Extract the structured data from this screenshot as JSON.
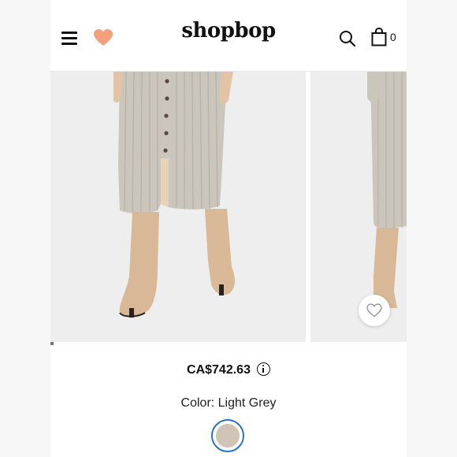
{
  "header": {
    "logo": "shopbop",
    "menu_icon": "menu-icon",
    "wishlist_icon": "heart-icon",
    "search_icon": "search-icon",
    "bag_icon": "shopping-bag-icon",
    "bag_count": "0"
  },
  "gallery": {
    "images": [
      "product-photo-front",
      "product-photo-side"
    ],
    "wishlist_icon": "heart-outline-icon",
    "current_slide": 1
  },
  "product": {
    "price": "CA$742.63",
    "info_icon": "info-icon",
    "color_label": "Color: Light Grey",
    "swatch_color": "#cfc4b6"
  },
  "colors": {
    "accent_heart": "#f4a07a",
    "swatch_ring": "#2b72c8"
  }
}
